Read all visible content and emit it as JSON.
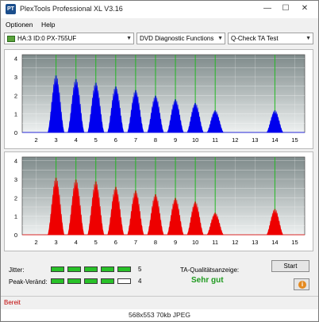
{
  "window": {
    "app_icon": "plextools-icon",
    "title": "PlexTools Professional XL V3.16",
    "minimize": "—",
    "maximize": "☐",
    "close": "✕"
  },
  "menu": {
    "items": [
      "Optionen",
      "Help"
    ]
  },
  "toolbar": {
    "drive": "HA:3 ID:0  PX-755UF",
    "function": "DVD Diagnostic Functions",
    "test": "Q-Check TA Test",
    "arrow": "▼"
  },
  "colors": {
    "upper_fill": "#0000ee",
    "lower_fill": "#ee0000",
    "marker_line": "#22b822",
    "plot_bg_top": "#7e8a8a",
    "plot_bg_bottom": "#eef1f1"
  },
  "chart_data": [
    {
      "type": "area",
      "panel": "upper",
      "x_ticks": [
        "2",
        "3",
        "4",
        "5",
        "6",
        "7",
        "8",
        "9",
        "10",
        "11",
        "12",
        "13",
        "14",
        "15"
      ],
      "y_ticks": [
        "0",
        "0.5",
        "1",
        "1.5",
        "2",
        "2.5",
        "3",
        "3.5",
        "4"
      ],
      "xlim": [
        1.3,
        15.5
      ],
      "ylim": [
        0,
        4.2
      ],
      "grid": true,
      "markers": [
        3,
        4,
        5,
        6,
        7,
        8,
        9,
        10,
        11,
        14
      ],
      "peaks": [
        {
          "x": 3,
          "y": 3.1
        },
        {
          "x": 4,
          "y": 2.9
        },
        {
          "x": 5,
          "y": 2.7
        },
        {
          "x": 6,
          "y": 2.5
        },
        {
          "x": 7,
          "y": 2.3
        },
        {
          "x": 8,
          "y": 2.0
        },
        {
          "x": 9,
          "y": 1.8
        },
        {
          "x": 10,
          "y": 1.6
        },
        {
          "x": 11,
          "y": 1.2
        },
        {
          "x": 14,
          "y": 1.2
        }
      ]
    },
    {
      "type": "area",
      "panel": "lower",
      "x_ticks": [
        "2",
        "3",
        "4",
        "5",
        "6",
        "7",
        "8",
        "9",
        "10",
        "11",
        "12",
        "13",
        "14",
        "15"
      ],
      "y_ticks": [
        "0",
        "0.5",
        "1",
        "1.5",
        "2",
        "2.5",
        "3",
        "3.5",
        "4"
      ],
      "xlim": [
        1.3,
        15.5
      ],
      "ylim": [
        0,
        4.2
      ],
      "grid": true,
      "markers": [
        3,
        4,
        5,
        6,
        7,
        8,
        9,
        10,
        11,
        14
      ],
      "peaks": [
        {
          "x": 3,
          "y": 3.1
        },
        {
          "x": 4,
          "y": 3.0
        },
        {
          "x": 5,
          "y": 2.9
        },
        {
          "x": 6,
          "y": 2.6
        },
        {
          "x": 7,
          "y": 2.4
        },
        {
          "x": 8,
          "y": 2.2
        },
        {
          "x": 9,
          "y": 2.0
        },
        {
          "x": 10,
          "y": 1.8
        },
        {
          "x": 11,
          "y": 1.2
        },
        {
          "x": 14,
          "y": 1.4
        }
      ]
    }
  ],
  "results": {
    "jitter_label": "Jitter:",
    "jitter_value": "5",
    "jitter_level": 5,
    "peak_label": "Peak-Veränd:",
    "peak_value": "4",
    "peak_level": 4,
    "meter_max": 5,
    "quality_label": "TA-Qualitätsanzeige:",
    "quality_value": "Sehr gut",
    "start_label": "Start",
    "info_icon": "info-icon"
  },
  "status": {
    "text": "Bereit"
  },
  "caption": "568x553 70kb JPEG"
}
